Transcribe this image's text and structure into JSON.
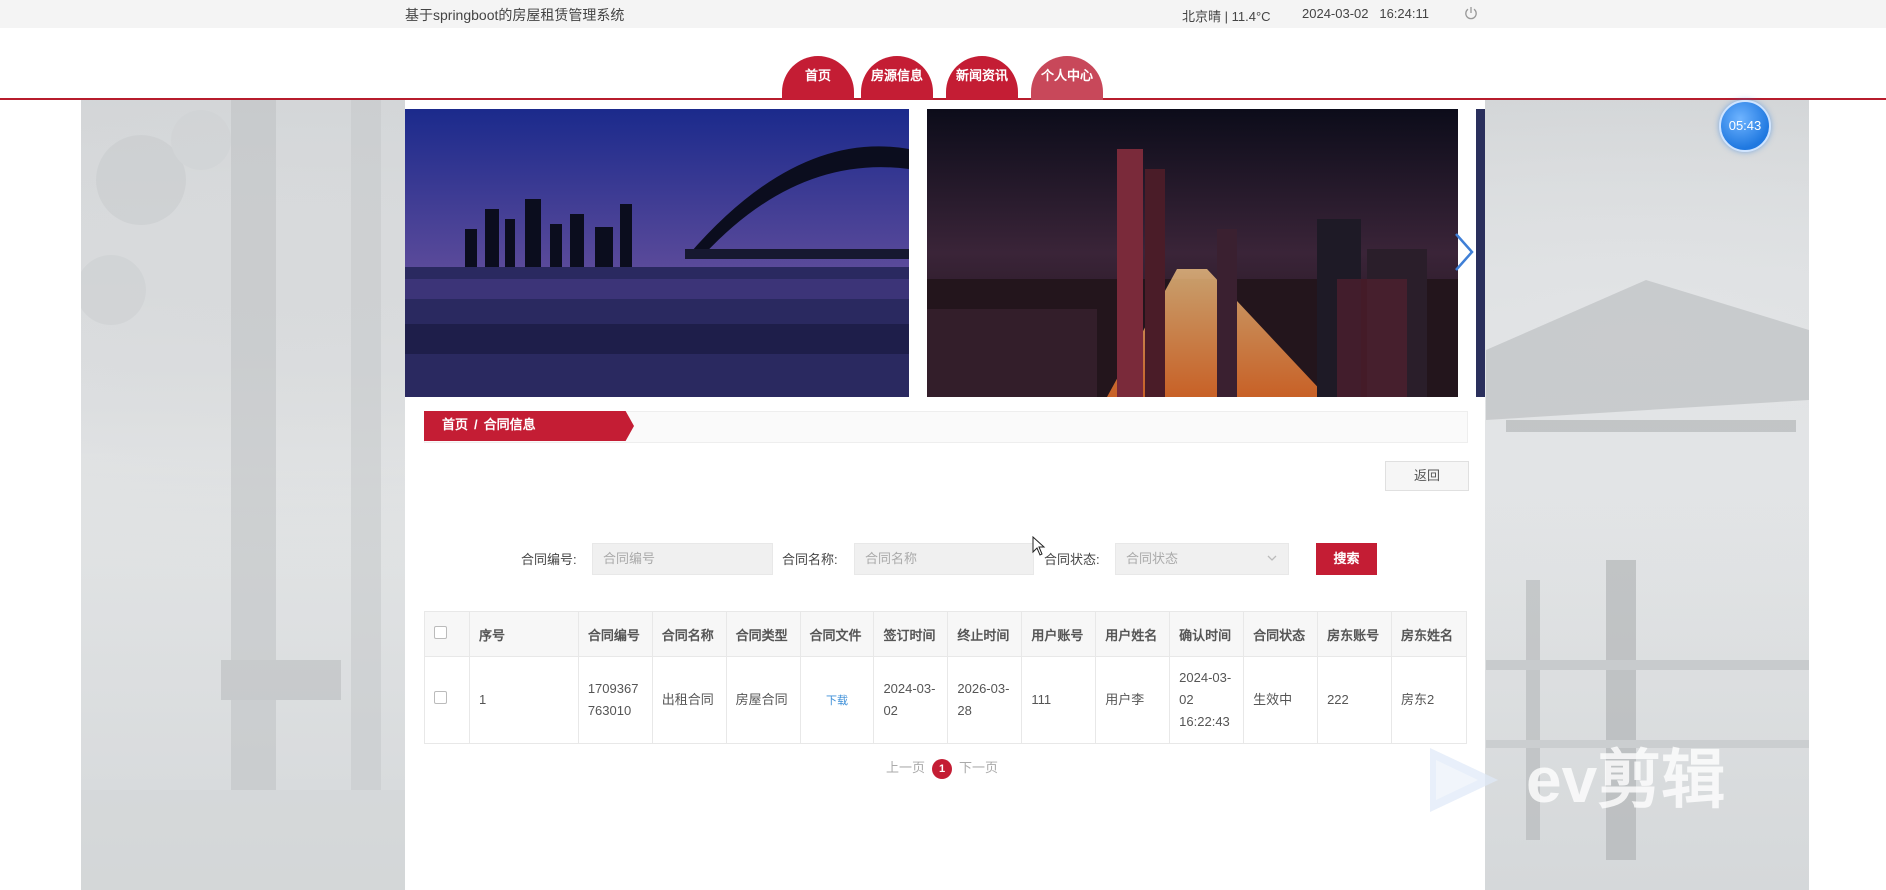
{
  "header": {
    "system_title": "基于springboot的房屋租赁管理系统",
    "weather": "北京晴 | 11.4°C",
    "date": "2024-03-02",
    "time": "16:24:11"
  },
  "nav": {
    "items": [
      {
        "label": "首页"
      },
      {
        "label": "房源信息"
      },
      {
        "label": "新闻资讯"
      },
      {
        "label": "个人中心"
      }
    ]
  },
  "clock_badge": "05:43",
  "breadcrumb": {
    "home": "首页",
    "separator": "/",
    "current": "合同信息"
  },
  "back_label": "返回",
  "search": {
    "contract_no_label": "合同编号:",
    "contract_no_placeholder": "合同编号",
    "contract_name_label": "合同名称:",
    "contract_name_placeholder": "合同名称",
    "status_label": "合同状态:",
    "status_placeholder": "合同状态",
    "button": "搜索"
  },
  "table": {
    "headers": [
      "序号",
      "合同编号",
      "合同名称",
      "合同类型",
      "合同文件",
      "签订时间",
      "终止时间",
      "用户账号",
      "用户姓名",
      "确认时间",
      "合同状态",
      "房东账号",
      "房东姓名"
    ],
    "rows": [
      {
        "index": "1",
        "contract_no": "1709367763010",
        "contract_name": "出租合同",
        "contract_type": "房屋合同",
        "file": "下载",
        "sign_date": "2024-03-02",
        "end_date": "2026-03-28",
        "user_account": "111",
        "user_name": "用户李",
        "confirm_time": "2024-03-02 16:22:43",
        "status": "生效中",
        "landlord_account": "222",
        "landlord_name": "房东2"
      }
    ]
  },
  "pager": {
    "prev": "上一页",
    "current": "1",
    "next": "下一页"
  },
  "watermark": "ev剪辑",
  "colors": {
    "brand_red": "#c41d34",
    "link_blue": "#3d8fd8"
  }
}
